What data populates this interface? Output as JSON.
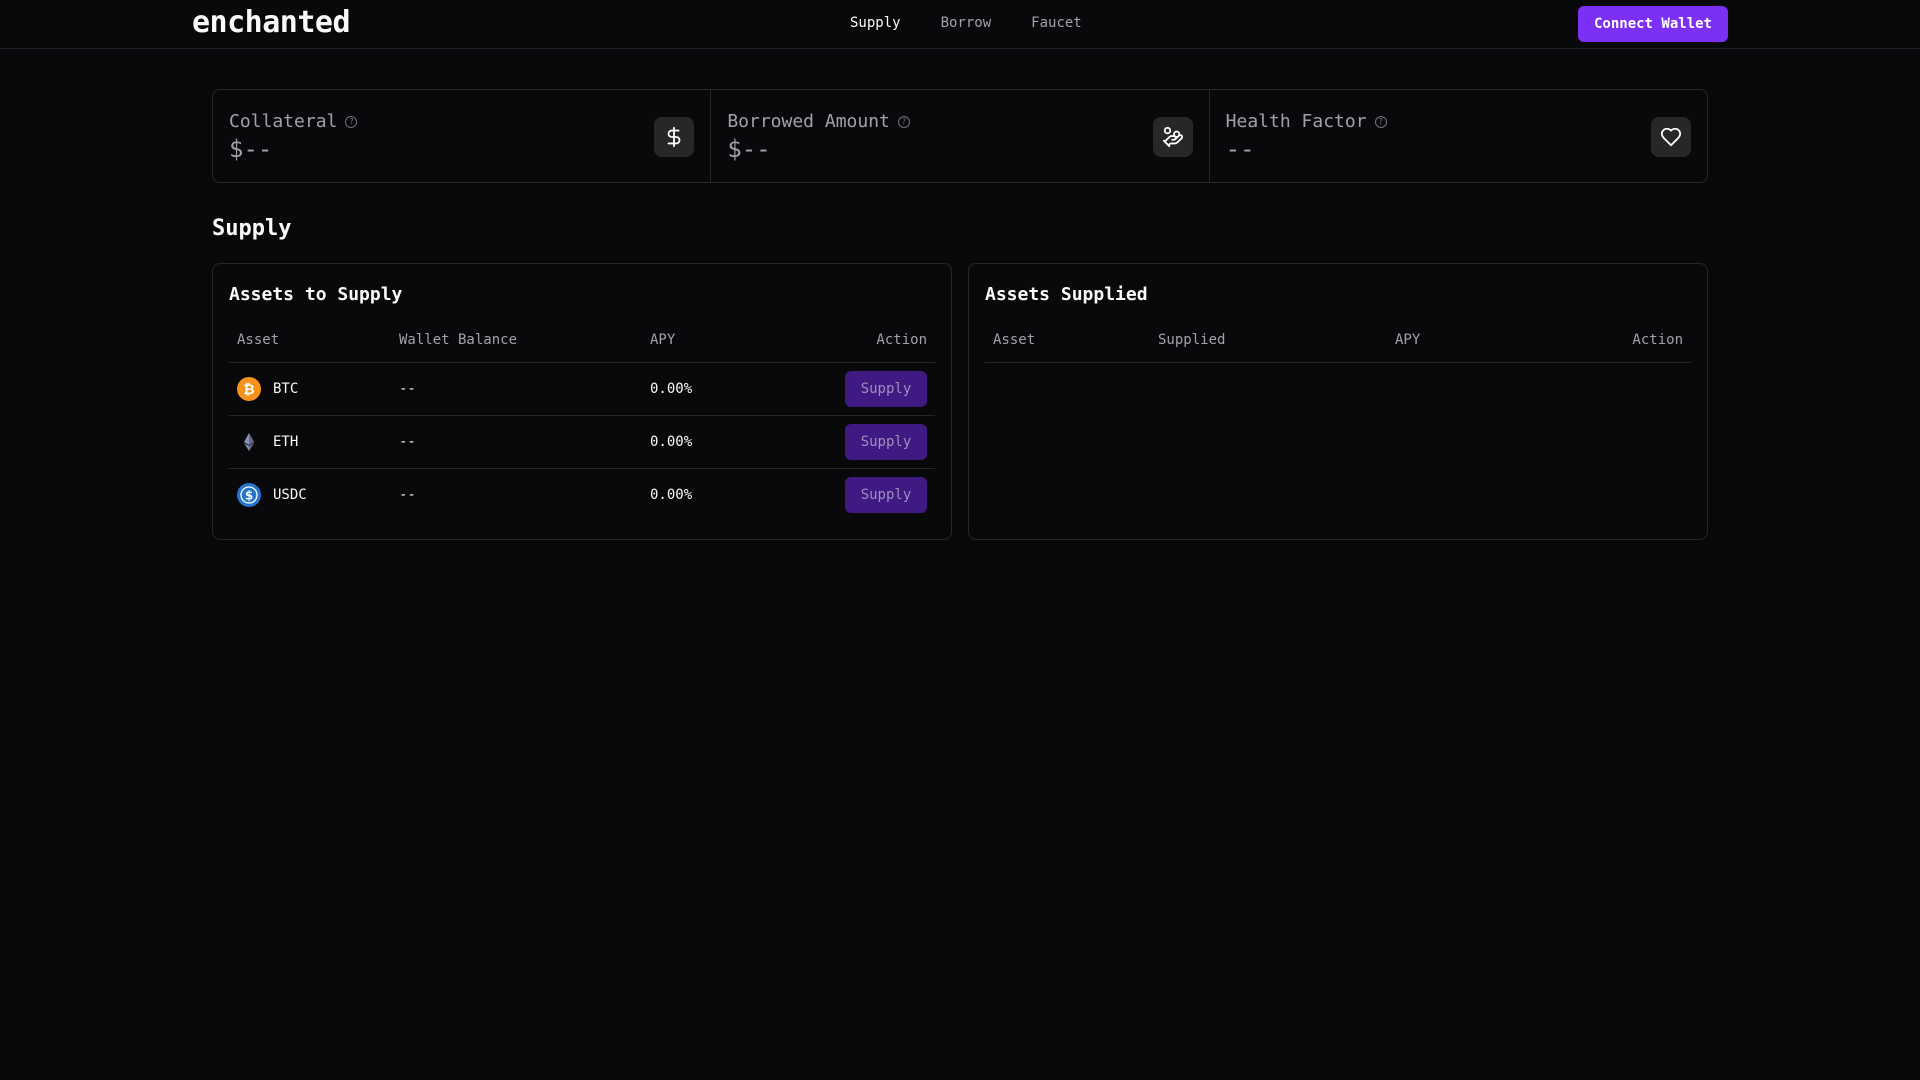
{
  "header": {
    "logo": "enchanted",
    "nav": [
      {
        "label": "Supply",
        "active": true
      },
      {
        "label": "Borrow",
        "active": false
      },
      {
        "label": "Faucet",
        "active": false
      }
    ],
    "connect_label": "Connect Wallet"
  },
  "stats": [
    {
      "label": "Collateral",
      "value": "$--",
      "icon": "dollar-icon"
    },
    {
      "label": "Borrowed Amount",
      "value": "$--",
      "icon": "hand-coins-icon"
    },
    {
      "label": "Health Factor",
      "value": "--",
      "icon": "heart-icon"
    }
  ],
  "section_title": "Supply",
  "assets_to_supply": {
    "title": "Assets to Supply",
    "columns": [
      "Asset",
      "Wallet Balance",
      "APY",
      "Action"
    ],
    "rows": [
      {
        "asset": "BTC",
        "icon": "btc-icon",
        "balance": "--",
        "apy": "0.00%",
        "action": "Supply"
      },
      {
        "asset": "ETH",
        "icon": "eth-icon",
        "balance": "--",
        "apy": "0.00%",
        "action": "Supply"
      },
      {
        "asset": "USDC",
        "icon": "usdc-icon",
        "balance": "--",
        "apy": "0.00%",
        "action": "Supply"
      }
    ]
  },
  "assets_supplied": {
    "title": "Assets Supplied",
    "columns": [
      "Asset",
      "Supplied",
      "APY",
      "Action"
    ]
  },
  "colors": {
    "accent": "#7c2ff5",
    "supply_button": "#3f1a82",
    "btc": "#f7931a",
    "usdc": "#2775ca",
    "background": "#09090b"
  }
}
